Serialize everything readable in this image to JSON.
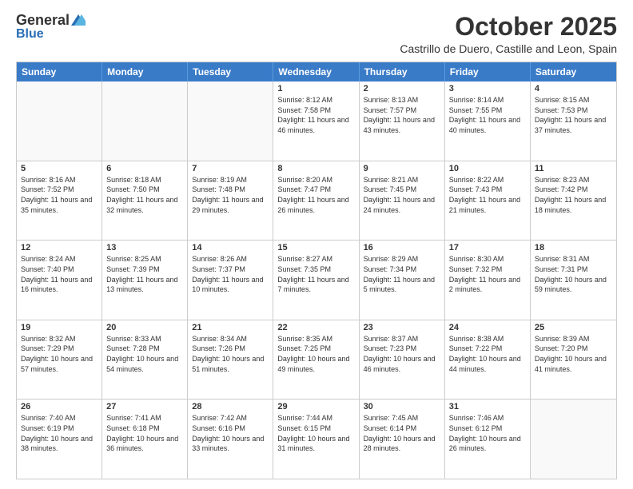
{
  "logo": {
    "general": "General",
    "blue": "Blue"
  },
  "header": {
    "month": "October 2025",
    "location": "Castrillo de Duero, Castille and Leon, Spain"
  },
  "weekdays": [
    "Sunday",
    "Monday",
    "Tuesday",
    "Wednesday",
    "Thursday",
    "Friday",
    "Saturday"
  ],
  "rows": [
    [
      {
        "day": "",
        "info": ""
      },
      {
        "day": "",
        "info": ""
      },
      {
        "day": "",
        "info": ""
      },
      {
        "day": "1",
        "info": "Sunrise: 8:12 AM\nSunset: 7:58 PM\nDaylight: 11 hours and 46 minutes."
      },
      {
        "day": "2",
        "info": "Sunrise: 8:13 AM\nSunset: 7:57 PM\nDaylight: 11 hours and 43 minutes."
      },
      {
        "day": "3",
        "info": "Sunrise: 8:14 AM\nSunset: 7:55 PM\nDaylight: 11 hours and 40 minutes."
      },
      {
        "day": "4",
        "info": "Sunrise: 8:15 AM\nSunset: 7:53 PM\nDaylight: 11 hours and 37 minutes."
      }
    ],
    [
      {
        "day": "5",
        "info": "Sunrise: 8:16 AM\nSunset: 7:52 PM\nDaylight: 11 hours and 35 minutes."
      },
      {
        "day": "6",
        "info": "Sunrise: 8:18 AM\nSunset: 7:50 PM\nDaylight: 11 hours and 32 minutes."
      },
      {
        "day": "7",
        "info": "Sunrise: 8:19 AM\nSunset: 7:48 PM\nDaylight: 11 hours and 29 minutes."
      },
      {
        "day": "8",
        "info": "Sunrise: 8:20 AM\nSunset: 7:47 PM\nDaylight: 11 hours and 26 minutes."
      },
      {
        "day": "9",
        "info": "Sunrise: 8:21 AM\nSunset: 7:45 PM\nDaylight: 11 hours and 24 minutes."
      },
      {
        "day": "10",
        "info": "Sunrise: 8:22 AM\nSunset: 7:43 PM\nDaylight: 11 hours and 21 minutes."
      },
      {
        "day": "11",
        "info": "Sunrise: 8:23 AM\nSunset: 7:42 PM\nDaylight: 11 hours and 18 minutes."
      }
    ],
    [
      {
        "day": "12",
        "info": "Sunrise: 8:24 AM\nSunset: 7:40 PM\nDaylight: 11 hours and 16 minutes."
      },
      {
        "day": "13",
        "info": "Sunrise: 8:25 AM\nSunset: 7:39 PM\nDaylight: 11 hours and 13 minutes."
      },
      {
        "day": "14",
        "info": "Sunrise: 8:26 AM\nSunset: 7:37 PM\nDaylight: 11 hours and 10 minutes."
      },
      {
        "day": "15",
        "info": "Sunrise: 8:27 AM\nSunset: 7:35 PM\nDaylight: 11 hours and 7 minutes."
      },
      {
        "day": "16",
        "info": "Sunrise: 8:29 AM\nSunset: 7:34 PM\nDaylight: 11 hours and 5 minutes."
      },
      {
        "day": "17",
        "info": "Sunrise: 8:30 AM\nSunset: 7:32 PM\nDaylight: 11 hours and 2 minutes."
      },
      {
        "day": "18",
        "info": "Sunrise: 8:31 AM\nSunset: 7:31 PM\nDaylight: 10 hours and 59 minutes."
      }
    ],
    [
      {
        "day": "19",
        "info": "Sunrise: 8:32 AM\nSunset: 7:29 PM\nDaylight: 10 hours and 57 minutes."
      },
      {
        "day": "20",
        "info": "Sunrise: 8:33 AM\nSunset: 7:28 PM\nDaylight: 10 hours and 54 minutes."
      },
      {
        "day": "21",
        "info": "Sunrise: 8:34 AM\nSunset: 7:26 PM\nDaylight: 10 hours and 51 minutes."
      },
      {
        "day": "22",
        "info": "Sunrise: 8:35 AM\nSunset: 7:25 PM\nDaylight: 10 hours and 49 minutes."
      },
      {
        "day": "23",
        "info": "Sunrise: 8:37 AM\nSunset: 7:23 PM\nDaylight: 10 hours and 46 minutes."
      },
      {
        "day": "24",
        "info": "Sunrise: 8:38 AM\nSunset: 7:22 PM\nDaylight: 10 hours and 44 minutes."
      },
      {
        "day": "25",
        "info": "Sunrise: 8:39 AM\nSunset: 7:20 PM\nDaylight: 10 hours and 41 minutes."
      }
    ],
    [
      {
        "day": "26",
        "info": "Sunrise: 7:40 AM\nSunset: 6:19 PM\nDaylight: 10 hours and 38 minutes."
      },
      {
        "day": "27",
        "info": "Sunrise: 7:41 AM\nSunset: 6:18 PM\nDaylight: 10 hours and 36 minutes."
      },
      {
        "day": "28",
        "info": "Sunrise: 7:42 AM\nSunset: 6:16 PM\nDaylight: 10 hours and 33 minutes."
      },
      {
        "day": "29",
        "info": "Sunrise: 7:44 AM\nSunset: 6:15 PM\nDaylight: 10 hours and 31 minutes."
      },
      {
        "day": "30",
        "info": "Sunrise: 7:45 AM\nSunset: 6:14 PM\nDaylight: 10 hours and 28 minutes."
      },
      {
        "day": "31",
        "info": "Sunrise: 7:46 AM\nSunset: 6:12 PM\nDaylight: 10 hours and 26 minutes."
      },
      {
        "day": "",
        "info": ""
      }
    ]
  ]
}
